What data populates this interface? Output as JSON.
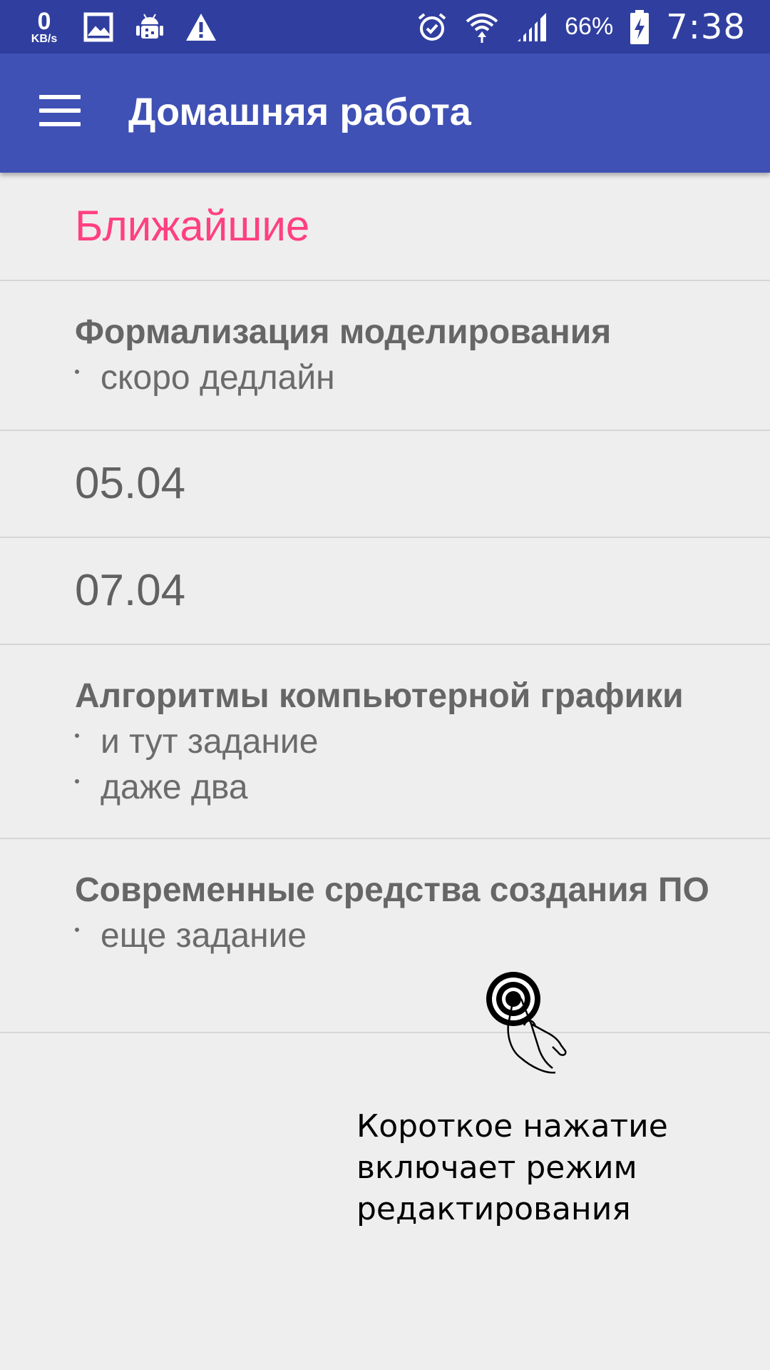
{
  "status_bar": {
    "speed_value": "0",
    "speed_unit": "KB/s",
    "icons_left": [
      "image-icon",
      "android-debug-icon",
      "warning-icon"
    ],
    "icons_right": [
      "alarm-icon",
      "wifi-icon",
      "signal-icon"
    ],
    "battery_percent": "66%",
    "time": "7:38"
  },
  "app_bar": {
    "title": "Домашняя работа",
    "menu_icon": "hamburger-menu-icon"
  },
  "list": {
    "section_header": "Ближайшие",
    "items": [
      {
        "type": "subject",
        "title": "Формализация моделирования",
        "tasks": [
          "скоро дедлайн"
        ]
      },
      {
        "type": "date",
        "label": "05.04"
      },
      {
        "type": "date",
        "label": "07.04"
      },
      {
        "type": "subject",
        "title": "Алгоритмы компьютерной графики",
        "tasks": [
          "и тут задание",
          "даже два"
        ]
      },
      {
        "type": "subject",
        "title": "Современные средства создания ПО",
        "tasks": [
          "еще задание"
        ]
      }
    ]
  },
  "hint": {
    "lines": [
      "Короткое нажатие",
      "включает режим",
      "редактирования"
    ],
    "icon": "tap-gesture-icon"
  },
  "colors": {
    "status_bar": "#303f9f",
    "app_bar": "#3f51b5",
    "accent": "#ff4081",
    "background": "#eeeeee"
  }
}
